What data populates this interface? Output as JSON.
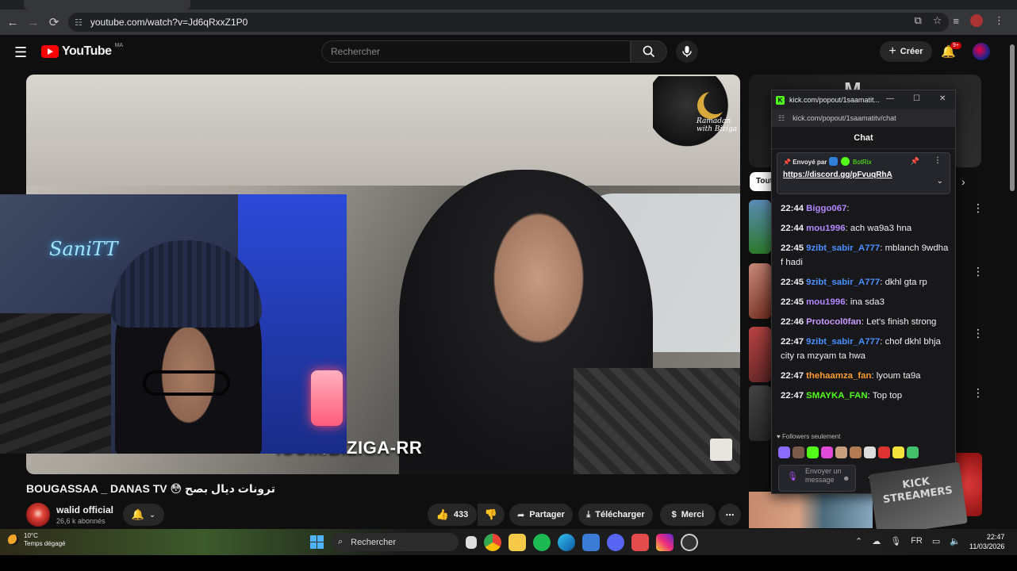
{
  "browser": {
    "url": "youtube.com/watch?v=Jd6qRxxZ1P0",
    "nav": {
      "back": "←",
      "forward": "→",
      "reload": "⟳"
    }
  },
  "youtube": {
    "logo_text": "YouTube",
    "region": "MA",
    "search_placeholder": "Rechercher",
    "create_label": "Créer",
    "notif_count": "9+",
    "video": {
      "overlay_text": ".COM/BIZIGA-RR",
      "badge_text": "Ramadan with Biziga",
      "neon_text": "SaniTT"
    },
    "title": "BOUGASSAA _ DANAS TV 😳 ترونات ديال بصح",
    "channel": {
      "name": "walid official",
      "subs": "26,6 k abonnés"
    },
    "actions": {
      "likes": "433",
      "share": "Partager",
      "download": "Télécharger",
      "thanks": "Merci"
    },
    "sidebar": {
      "chip_label": "Tout",
      "ad_logo": "M"
    }
  },
  "kick": {
    "window_title": "kick.com/popout/1saamatit...",
    "url": "kick.com/popout/1saamatitv/chat",
    "chat_title": "Chat",
    "pinned": {
      "by_label": "Envoyé par",
      "bot_name": "BotRix",
      "link": "https://discord.gg/pFvuqRhA"
    },
    "messages": [
      {
        "time": "22:44",
        "user": "Biggo067",
        "color": "#b388ff",
        "text": ""
      },
      {
        "time": "22:44",
        "user": "mou1996",
        "color": "#b388ff",
        "text": "ach wa9a3 hna"
      },
      {
        "time": "22:45",
        "user": "9zibt_sabir_A777",
        "color": "#4a8fff",
        "text": "mblanch 9wdha f hadi"
      },
      {
        "time": "22:45",
        "user": "9zibt_sabir_A777",
        "color": "#4a8fff",
        "text": "dkhl gta rp"
      },
      {
        "time": "22:45",
        "user": "mou1996",
        "color": "#b388ff",
        "text": "ina sda3"
      },
      {
        "time": "22:46",
        "user": "Protocol0fan",
        "color": "#c79bff",
        "text": "Let's finish strong"
      },
      {
        "time": "22:47",
        "user": "9zibt_sabir_A777",
        "color": "#4a8fff",
        "text": "chof dkhl bhja city ra mzyam ta hwa"
      },
      {
        "time": "22:47",
        "user": "thehaamza_fan",
        "color": "#ff9d2e",
        "text": "lyoum ta9a"
      },
      {
        "time": "22:47",
        "user": "SMAYKA_FAN",
        "color": "#53fc18",
        "text": "Top top"
      }
    ],
    "followers_only": "Followers seulement",
    "send_placeholder": "Envoyer un message"
  },
  "overlay_card": "KICK STREAMERS",
  "taskbar": {
    "weather_temp": "10°C",
    "weather_desc": "Temps dégagé",
    "search_label": "Rechercher",
    "lang": "FR",
    "time": "22:47",
    "date": "11/03/2026"
  }
}
